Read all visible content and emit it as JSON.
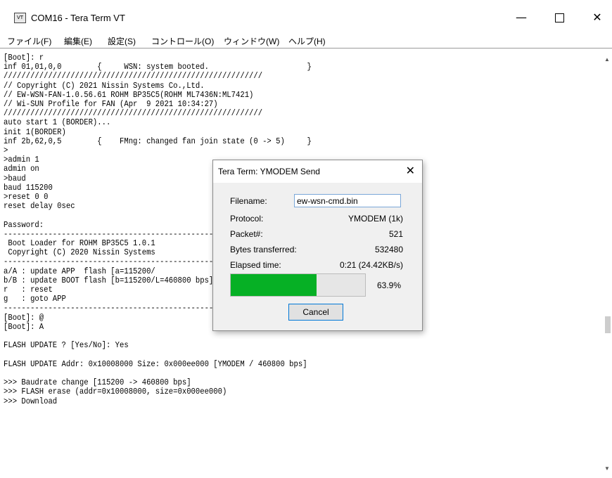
{
  "window": {
    "icon_text": "VT",
    "title": "COM16 - Tera Term VT",
    "minimize": "—",
    "close": "✕"
  },
  "menu": [
    "ファイル(F)",
    "編集(E)",
    "設定(S)",
    "コントロール(O)",
    "ウィンドウ(W)",
    "ヘルプ(H)"
  ],
  "terminal": {
    "lines": [
      "[Boot]: r",
      "inf 01,01,0,0        {     WSN: system booted.                      }",
      "//////////////////////////////////////////////////////////",
      "// Copyright (C) 2021 Nissin Systems Co.,Ltd.",
      "// EW-WSN-FAN-1.0.56.61 ROHM BP35C5(ROHM ML7436N:ML7421)",
      "// Wi-SUN Profile for FAN (Apr  9 2021 10:34:27)",
      "//////////////////////////////////////////////////////////",
      "auto start 1 (BORDER)...",
      "init 1(BORDER)",
      "inf 2b,62,0,5        {    FMng: changed fan join state (0 -> 5)     }",
      ">",
      ">admin 1",
      "admin on",
      ">baud",
      "baud 115200",
      ">reset 0 0",
      "reset delay 0sec",
      "",
      "Password:",
      "------------------------------------------------------------",
      " Boot Loader for ROHM BP35C5 1.0.1",
      " Copyright (C) 2020 Nissin Systems",
      "------------------------------------------------------------",
      "a/A : update APP  flash [a=115200/",
      "b/B : update BOOT flash [b=115200/L=460800 bps]",
      "r   : reset",
      "g   : goto APP",
      "------------------------------------------------------------",
      "[Boot]: @",
      "[Boot]: A",
      "",
      "FLASH UPDATE ? [Yes/No]: Yes",
      "",
      "FLASH UPDATE Addr: 0x10008000 Size: 0x000ee000 [YMODEM / 460800 bps]",
      "",
      ">>> Baudrate change [115200 -> 460800 bps]",
      ">>> FLASH erase (addr=0x10008000, size=0x000ee000)",
      ">>> Download"
    ]
  },
  "dialog": {
    "title": "Tera Term: YMODEM Send",
    "close": "✕",
    "filename_label": "Filename:",
    "filename_value": "ew-wsn-cmd.bin",
    "protocol_label": "Protocol:",
    "protocol_value": "YMODEM (1k)",
    "packet_label": "Packet#:",
    "packet_value": "521",
    "bytes_label": "Bytes transferred:",
    "bytes_value": "532480",
    "elapsed_label": "Elapsed time:",
    "elapsed_value": "0:21 (24.42KB/s)",
    "progress_fraction": 0.639,
    "progress_text": "63.9%",
    "cancel_label": "Cancel",
    "progress_color": "#06b025"
  }
}
